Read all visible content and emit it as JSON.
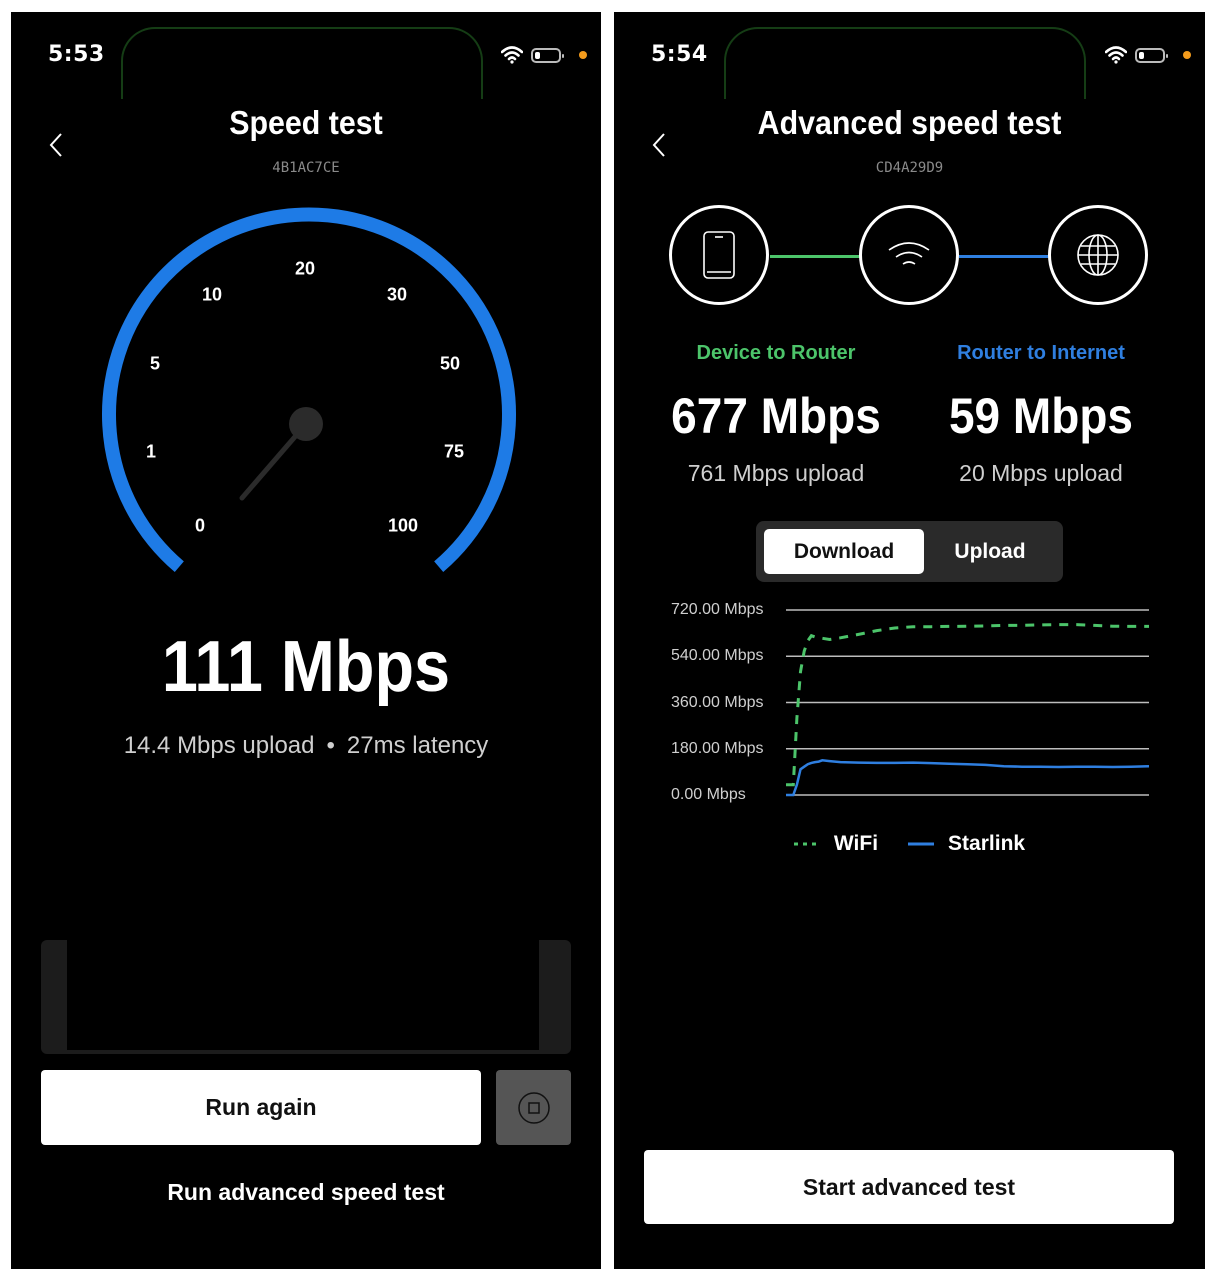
{
  "left_screen": {
    "status_bar": {
      "time": "5:53",
      "icons": [
        "wifi-icon",
        "battery-icon",
        "privacy-dot"
      ]
    },
    "header": {
      "title": "Speed test",
      "serial": "4B1AC7CE",
      "back_icon": "chevron-left-icon"
    },
    "gauge": {
      "ticks": [
        "0",
        "1",
        "5",
        "10",
        "20",
        "30",
        "50",
        "75",
        "100"
      ],
      "needle_value_label": "0",
      "accent": "#1e7be6"
    },
    "result": {
      "download": "111 Mbps",
      "upload": "14.4 Mbps upload",
      "separator": "•",
      "latency": "27ms latency"
    },
    "buttons": {
      "run_again": "Run again",
      "stop_icon": "stop-icon",
      "advanced_link": "Run advanced speed test"
    }
  },
  "right_screen": {
    "status_bar": {
      "time": "5:54",
      "icons": [
        "wifi-icon",
        "battery-icon",
        "privacy-dot"
      ]
    },
    "header": {
      "title": "Advanced speed test",
      "serial": "CD4A29D9",
      "back_icon": "chevron-left-icon"
    },
    "path": {
      "nodes": [
        "phone-icon",
        "router-wifi-icon",
        "globe-icon"
      ],
      "link_colors": [
        "#4cc46a",
        "#2f7fe0"
      ]
    },
    "segments": [
      {
        "label": "Device to Router",
        "color": "#4cc46a",
        "download": "677 Mbps",
        "upload": "761 Mbps upload"
      },
      {
        "label": "Router to Internet",
        "color": "#2f7fe0",
        "download": "59 Mbps",
        "upload": "20 Mbps upload"
      }
    ],
    "toggle": {
      "options": [
        "Download",
        "Upload"
      ],
      "selected": "Download"
    },
    "buttons": {
      "start": "Start advanced test"
    }
  },
  "chart_data": {
    "type": "line",
    "title": "",
    "xlabel": "",
    "ylabel": "",
    "ylim": [
      0,
      720
    ],
    "y_ticks": [
      "720.00 Mbps",
      "540.00 Mbps",
      "360.00 Mbps",
      "180.00 Mbps",
      "0.00 Mbps"
    ],
    "y_tick_values": [
      720,
      540,
      360,
      180,
      0
    ],
    "grid": true,
    "legend_position": "bottom-center",
    "x": [
      0,
      1,
      2,
      3,
      4,
      5,
      6,
      7,
      8,
      9,
      10,
      12,
      15,
      20,
      25,
      30,
      35,
      40,
      45,
      50,
      55,
      60,
      65,
      70,
      75,
      80,
      85,
      90,
      95,
      100
    ],
    "series": [
      {
        "name": "WiFi",
        "style": "dashed",
        "color": "#4cc46a",
        "values": [
          40,
          40,
          40,
          300,
          480,
          560,
          600,
          620,
          615,
          612,
          610,
          605,
          612,
          625,
          640,
          650,
          655,
          655,
          656,
          657,
          658,
          660,
          660,
          662,
          663,
          663,
          660,
          657,
          656,
          656
        ]
      },
      {
        "name": "Starlink",
        "style": "solid",
        "color": "#2f7fe0",
        "values": [
          0,
          0,
          0,
          40,
          100,
          110,
          120,
          125,
          128,
          130,
          135,
          132,
          128,
          126,
          125,
          125,
          126,
          124,
          122,
          120,
          117,
          112,
          110,
          110,
          109,
          110,
          110,
          109,
          110,
          112
        ]
      }
    ]
  }
}
